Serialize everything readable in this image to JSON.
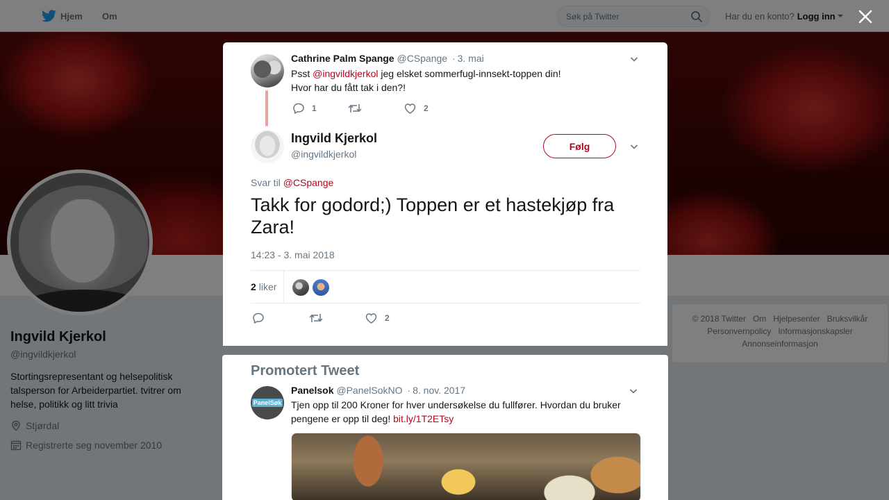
{
  "topnav": {
    "home_label": "Hjem",
    "about_label": "Om",
    "search_placeholder": "Søk på Twitter",
    "login_prompt": "Har du en konto?",
    "login_label": "Logg inn"
  },
  "profile": {
    "name": "Ingvild Kjerkol",
    "handle": "@ingvildkjerkol",
    "bio": "Stortingsrepresentant og helsepolitisk talsperson for Arbeiderpartiet. tvitrer om helse, politikk og litt trivia",
    "location": "Stjørdal",
    "joined": "Registrerte seg november 2010"
  },
  "footer": {
    "links": [
      "© 2018 Twitter",
      "Om",
      "Hjelpesenter",
      "Bruksvilkår",
      "Personvernpolicy",
      "Informasjonskapsler",
      "Annonseinformasjon"
    ]
  },
  "parent_tweet": {
    "fullname": "Cathrine Palm Spange",
    "handle": "@CSpange",
    "time": "3. mai",
    "text_prefix": "Psst ",
    "mention": "@ingvildkjerkol",
    "text_suffix": " jeg elsket sommerfugl-innsekt-toppen din!",
    "text_line2": "Hvor har du fått tak i den?!",
    "reply_count": "1",
    "retweet_count": "",
    "like_count": "2"
  },
  "main_tweet": {
    "fullname": "Ingvild Kjerkol",
    "handle": "@ingvildkjerkol",
    "follow_label": "Følg",
    "reply_to_label": "Svar til",
    "reply_to_handle": "@CSpange",
    "text": "Takk for godord;) Toppen er et hastekjøp fra Zara!",
    "timestamp": "14:23 - 3. mai 2018",
    "likes_count": "2",
    "likes_label": "liker",
    "like_count": "2"
  },
  "promoted": {
    "section_title": "Promotert Tweet",
    "avatar_label": "PanelSøk",
    "fullname": "Panelsok",
    "handle": "@PanelSokNO",
    "time": "8. nov. 2017",
    "text": "Tjen opp til 200 Kroner for hver undersøkelse du fullfører. Hvordan du bruker pengene er opp til deg! ",
    "link": "bit.ly/1T2ETsy"
  },
  "colors": {
    "accent": "#b2071d",
    "secondary_text": "#657786",
    "overlay": "rgba(0,0,0,0.5)"
  },
  "icons": [
    "twitter-bird-icon",
    "search-icon",
    "close-icon",
    "chevron-down-icon",
    "reply-icon",
    "retweet-icon",
    "heart-icon",
    "location-icon",
    "calendar-icon"
  ]
}
